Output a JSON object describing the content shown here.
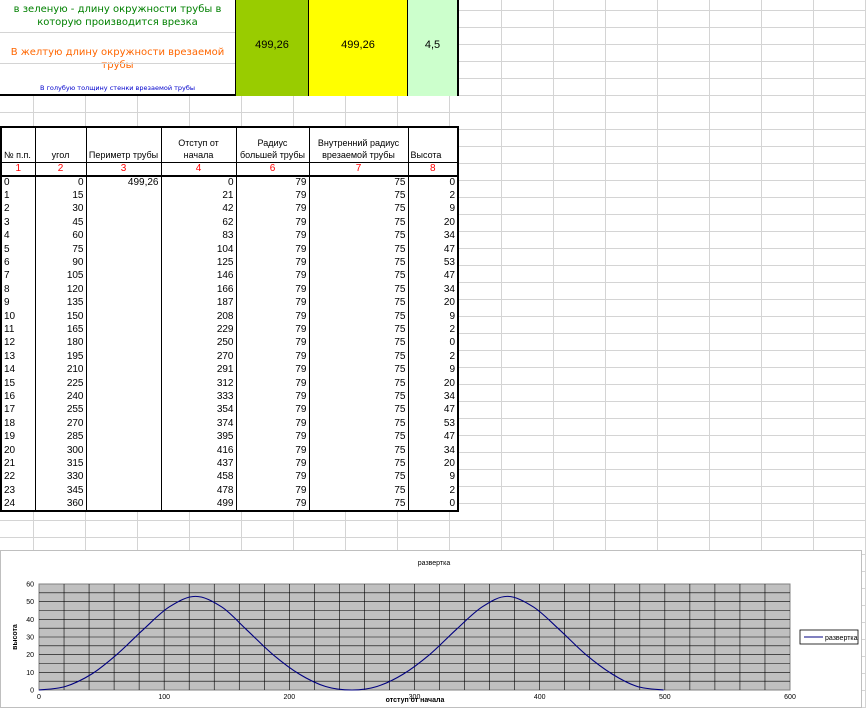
{
  "instructions": {
    "green_text": "в зеленую - длину окружности трубы в которую производится врезка",
    "orange_text": "В желтую длину окружности врезаемой трубы",
    "blue_text": "В голубую толщину стенки врезаемой трубы"
  },
  "inputs": {
    "green_value": "499,26",
    "yellow_value": "499,26",
    "lightgreen_value": "4,5"
  },
  "colors": {
    "green_cell": "#99cc00",
    "yellow_cell": "#ffff00",
    "lightgreen_cell": "#ccffcc",
    "chart_plot_bg": "#c0c0c0",
    "series_line": "#000080",
    "column_number_text": "#ff0000"
  },
  "table": {
    "headers": [
      "№ п.п.",
      "угол",
      "Периметр трубы",
      "Отступ от начала",
      "Радиус большей трубы",
      "Внутренний радиус врезаемой трубы",
      "Высота"
    ],
    "column_numbers": [
      "1",
      "2",
      "3",
      "4",
      "6",
      "7",
      "8"
    ],
    "rows": [
      [
        "0",
        "0",
        "499,26",
        "0",
        "79",
        "75",
        "0"
      ],
      [
        "1",
        "15",
        "",
        "21",
        "79",
        "75",
        "2"
      ],
      [
        "2",
        "30",
        "",
        "42",
        "79",
        "75",
        "9"
      ],
      [
        "3",
        "45",
        "",
        "62",
        "79",
        "75",
        "20"
      ],
      [
        "4",
        "60",
        "",
        "83",
        "79",
        "75",
        "34"
      ],
      [
        "5",
        "75",
        "",
        "104",
        "79",
        "75",
        "47"
      ],
      [
        "6",
        "90",
        "",
        "125",
        "79",
        "75",
        "53"
      ],
      [
        "7",
        "105",
        "",
        "146",
        "79",
        "75",
        "47"
      ],
      [
        "8",
        "120",
        "",
        "166",
        "79",
        "75",
        "34"
      ],
      [
        "9",
        "135",
        "",
        "187",
        "79",
        "75",
        "20"
      ],
      [
        "10",
        "150",
        "",
        "208",
        "79",
        "75",
        "9"
      ],
      [
        "11",
        "165",
        "",
        "229",
        "79",
        "75",
        "2"
      ],
      [
        "12",
        "180",
        "",
        "250",
        "79",
        "75",
        "0"
      ],
      [
        "13",
        "195",
        "",
        "270",
        "79",
        "75",
        "2"
      ],
      [
        "14",
        "210",
        "",
        "291",
        "79",
        "75",
        "9"
      ],
      [
        "15",
        "225",
        "",
        "312",
        "79",
        "75",
        "20"
      ],
      [
        "16",
        "240",
        "",
        "333",
        "79",
        "75",
        "34"
      ],
      [
        "17",
        "255",
        "",
        "354",
        "79",
        "75",
        "47"
      ],
      [
        "18",
        "270",
        "",
        "374",
        "79",
        "75",
        "53"
      ],
      [
        "19",
        "285",
        "",
        "395",
        "79",
        "75",
        "47"
      ],
      [
        "20",
        "300",
        "",
        "416",
        "79",
        "75",
        "34"
      ],
      [
        "21",
        "315",
        "",
        "437",
        "79",
        "75",
        "20"
      ],
      [
        "22",
        "330",
        "",
        "458",
        "79",
        "75",
        "9"
      ],
      [
        "23",
        "345",
        "",
        "478",
        "79",
        "75",
        "2"
      ],
      [
        "24",
        "360",
        "",
        "499",
        "79",
        "75",
        "0"
      ]
    ]
  },
  "chart_data": {
    "type": "scatter",
    "title": "развертка",
    "xlabel": "отступ от начала",
    "ylabel": "высота",
    "xlim": [
      0,
      600
    ],
    "ylim": [
      0,
      60
    ],
    "xticks": [
      "0",
      "100",
      "200",
      "300",
      "400",
      "500",
      "600"
    ],
    "yticks": [
      "0",
      "10",
      "20",
      "30",
      "40",
      "50",
      "60"
    ],
    "grid": true,
    "legend_position": "right",
    "series": [
      {
        "name": "развертка",
        "x": [
          0,
          21,
          42,
          62,
          83,
          104,
          125,
          146,
          166,
          187,
          208,
          229,
          250,
          270,
          291,
          312,
          333,
          354,
          374,
          395,
          416,
          437,
          458,
          478,
          499
        ],
        "y": [
          0,
          2,
          9,
          20,
          34,
          47,
          53,
          47,
          34,
          20,
          9,
          2,
          0,
          2,
          9,
          20,
          34,
          47,
          53,
          47,
          34,
          20,
          9,
          2,
          0
        ]
      }
    ]
  }
}
